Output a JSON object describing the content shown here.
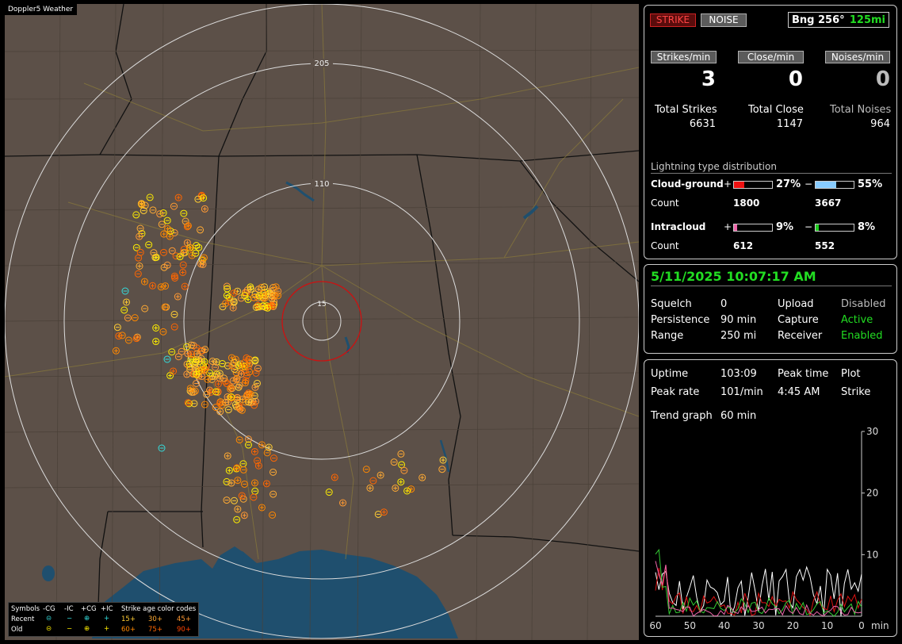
{
  "app": {
    "title": "Doppler5 Weather"
  },
  "map": {
    "range_rings": [
      {
        "label": "205",
        "color": "#dcdcdc"
      },
      {
        "label": "110",
        "color": "#dcdcdc"
      },
      {
        "label": "15",
        "color": "#dcdcdc"
      }
    ],
    "close_ring_color": "#cc1111",
    "land_color": "#5c5048",
    "water_color": "#1f4f6e"
  },
  "legend": {
    "symbols_label": "Symbols",
    "col_neg_cg": "-CG",
    "col_neg_ic": "-IC",
    "col_pos_cg": "+CG",
    "col_pos_ic": "+IC",
    "age_title": "Strike age color codes",
    "recent_label": "Recent",
    "old_label": "Old",
    "ages": [
      "15+",
      "30+",
      "45+",
      "60+",
      "75+",
      "90+"
    ],
    "age_colors": [
      "#ffcc33",
      "#ffaa33",
      "#ff9933",
      "#ff8800",
      "#ff6600",
      "#ff4400"
    ]
  },
  "status": {
    "strike_label": "STRIKE",
    "noise_label": "NOISE",
    "bearing": "Bng 256°",
    "distance": "125mi"
  },
  "rates": {
    "strikes_label": "Strikes/min",
    "close_label": "Close/min",
    "noises_label": "Noises/min",
    "strikes": "3",
    "close": "0",
    "noises": "0"
  },
  "totals": {
    "strikes_label": "Total Strikes",
    "close_label": "Total Close",
    "noises_label": "Total Noises",
    "strikes": "6631",
    "close": "1147",
    "noises": "964"
  },
  "distribution": {
    "title": "Lightning type distribution",
    "cg_label": "Cloud-ground",
    "ic_label": "Intracloud",
    "count_label": "Count",
    "plus": "+",
    "minus": "−",
    "cg_pos_pct": "27%",
    "cg_neg_pct": "55%",
    "cg_pos_count": "1800",
    "cg_neg_count": "3667",
    "ic_pos_pct": "9%",
    "ic_neg_pct": "8%",
    "ic_pos_count": "612",
    "ic_neg_count": "552",
    "cg_pos_frac": 0.27,
    "cg_neg_frac": 0.55,
    "ic_pos_frac": 0.09,
    "ic_neg_frac": 0.08,
    "cg_pos_color": "#ee1111",
    "cg_neg_color": "#88ccff",
    "ic_pos_color": "#ee66aa",
    "ic_neg_color": "#22cc22"
  },
  "settings": {
    "datetime": "5/11/2025 10:07:17 AM",
    "squelch_label": "Squelch",
    "squelch": "0",
    "persistence_label": "Persistence",
    "persistence": "90 min",
    "range_label": "Range",
    "range": "250 mi",
    "upload_label": "Upload",
    "upload": "Disabled",
    "capture_label": "Capture",
    "capture": "Active",
    "receiver_label": "Receiver",
    "receiver": "Enabled"
  },
  "stats": {
    "uptime_label": "Uptime",
    "uptime": "103:09",
    "peak_rate_label": "Peak rate",
    "peak_rate": "101/min",
    "peak_time_label": "Peak time",
    "peak_time": "4:45 AM",
    "plot_label": "Plot",
    "plot": "Strike",
    "trend_label": "Trend graph",
    "trend": "60 min"
  },
  "trend_graph": {
    "x_ticks": [
      "60",
      "50",
      "40",
      "30",
      "20",
      "10",
      "0"
    ],
    "x_unit": "min",
    "y_ticks": [
      "30",
      "20",
      "10"
    ],
    "ymax": 30
  }
}
